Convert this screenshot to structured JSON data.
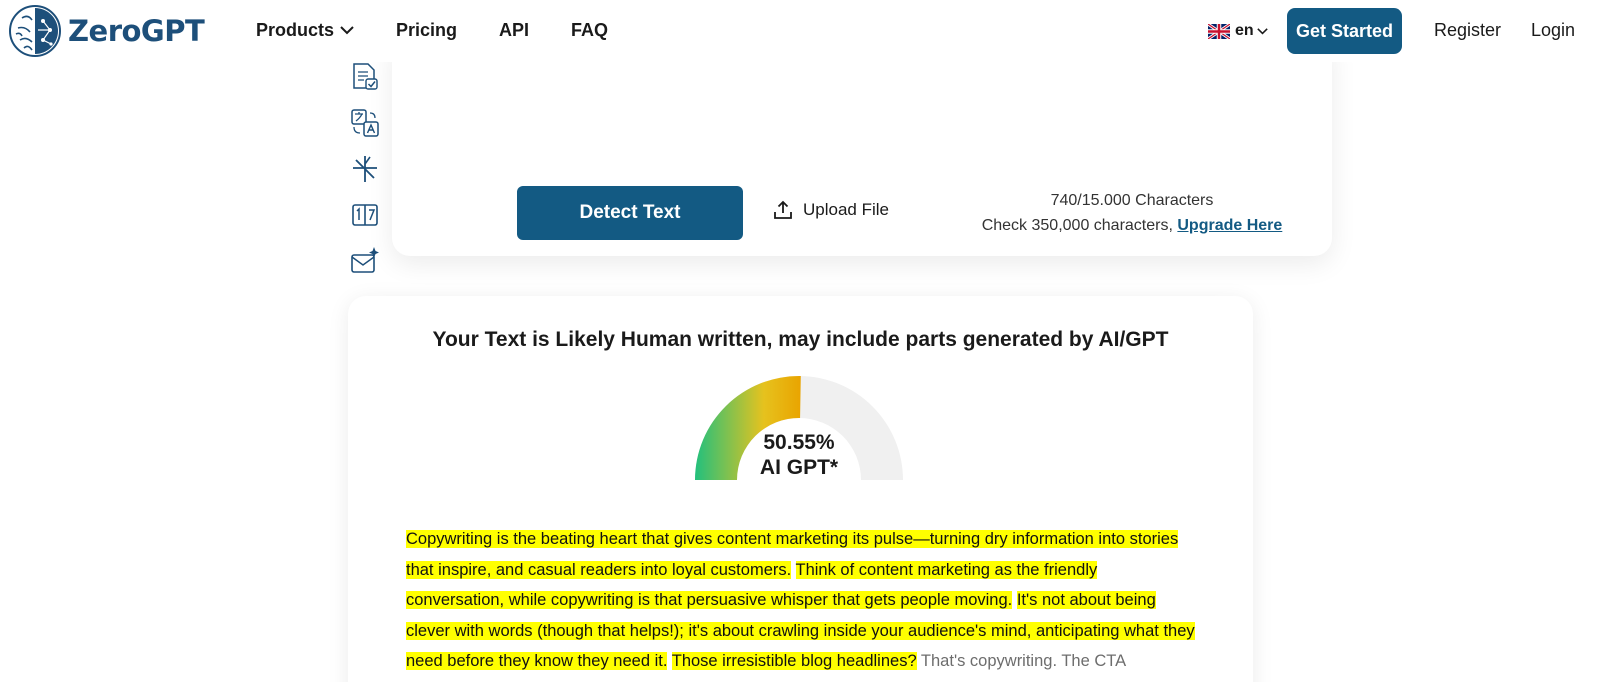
{
  "header": {
    "brand": "ZeroGPT",
    "nav": [
      {
        "label": "Products",
        "has_dropdown": true
      },
      {
        "label": "Pricing"
      },
      {
        "label": "API"
      },
      {
        "label": "FAQ"
      }
    ],
    "language": "en",
    "get_started": "Get Started",
    "register": "Register",
    "login": "Login"
  },
  "tools": [
    "document-check-icon",
    "translate-icon",
    "paraphrase-icon",
    "word-counter-icon",
    "email-ai-icon"
  ],
  "editor": {
    "detect_button": "Detect Text",
    "upload_label": "Upload File",
    "char_count": "740/15.000 Characters",
    "upgrade_prefix": "Check 350,000 characters,",
    "upgrade_link": "Upgrade Here"
  },
  "result": {
    "title": "Your Text is Likely Human written, may include parts generated by AI/GPT",
    "percent_label": "50.55%",
    "gauge_label": "AI GPT*",
    "ai_fraction": 0.5055,
    "segments": [
      {
        "text": "Copywriting is the beating heart that gives content marketing its pulse—turning dry information into stories that inspire, and casual readers into loyal customers.",
        "highlighted": true
      },
      {
        "text": "Think of content marketing as the friendly conversation, while copywriting is that persuasive whisper that gets people moving.",
        "highlighted": true
      },
      {
        "text": "It's not about being clever with words (though that helps!); it's about crawling inside your audience's mind, anticipating what they need before they know they need it.",
        "highlighted": true
      },
      {
        "text": "Those irresistible blog headlines?",
        "highlighted": true
      },
      {
        "text": "That's copywriting. The CTA",
        "highlighted": false
      }
    ]
  },
  "colors": {
    "brand": "#135a83",
    "highlight": "#ffff00",
    "gauge_start": "#22c07d",
    "gauge_end": "#e9a400",
    "gauge_track": "#f0f0f0"
  }
}
